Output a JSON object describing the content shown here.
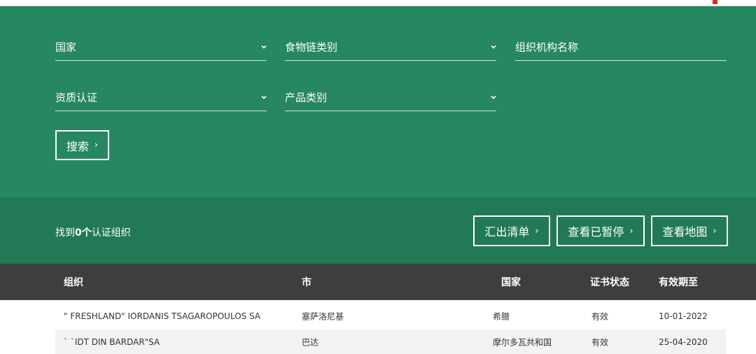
{
  "filters": {
    "country": "国家",
    "food_chain_category": "食物链类别",
    "organization_name": "组织机构名称",
    "qualification": "资质认证",
    "product_category": "产品类别"
  },
  "search_button": {
    "label": "搜索",
    "arrow": "›"
  },
  "results": {
    "prefix": "找到",
    "count": "0个",
    "suffix": "认证组织",
    "buttons": [
      {
        "label": "汇出清单",
        "arrow": "›"
      },
      {
        "label": "查看已暂停",
        "arrow": "›"
      },
      {
        "label": "查看地图",
        "arrow": "›"
      }
    ]
  },
  "table": {
    "headers": [
      "组织",
      "市",
      "国家",
      "证书状态",
      "有效期至"
    ],
    "rows": [
      [
        "\" FRESHLAND\" IORDANIS TSAGAROPOULOS SA",
        "塞萨洛尼基",
        "希腊",
        "有效",
        "10-01-2022"
      ],
      [
        "` `IDT DIN BARDAR\"SA",
        "巴达",
        "摩尔多瓦共和国",
        "有效",
        "25-04-2020"
      ]
    ]
  },
  "colors": {
    "panel_green": "#268760",
    "results_green": "#217a55",
    "header_dark": "#3e3e3e"
  },
  "icons": {
    "dropdown": "chevron-down-icon",
    "button_arrow": "chevron-right-icon"
  }
}
